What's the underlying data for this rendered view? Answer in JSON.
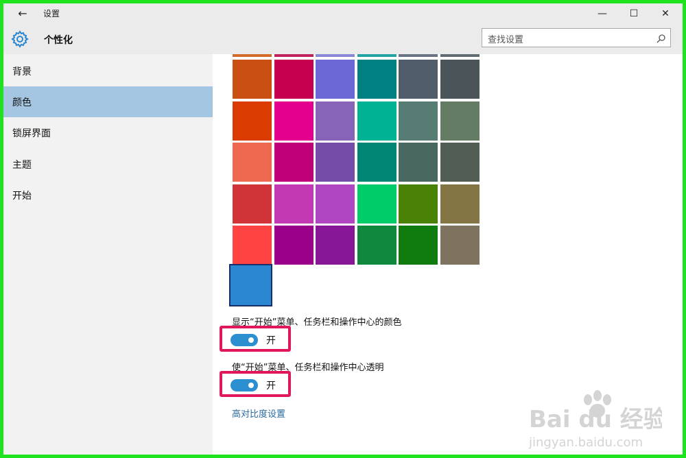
{
  "window": {
    "title": "设置",
    "back_glyph": "←",
    "minimize_glyph": "—",
    "maximize_glyph": "☐",
    "close_glyph": "✕"
  },
  "header": {
    "section_title": "个性化",
    "search_placeholder": "查找设置"
  },
  "sidebar": {
    "items": [
      {
        "label": "背景",
        "active": false
      },
      {
        "label": "颜色",
        "active": true
      },
      {
        "label": "锁屏界面",
        "active": false
      },
      {
        "label": "主题",
        "active": false
      },
      {
        "label": "开始",
        "active": false
      }
    ]
  },
  "content": {
    "color_grid": [
      [
        "#c94f12",
        "#c4004f",
        "#6b69d6",
        "#008080",
        "#515c6b",
        "#4a5459"
      ],
      [
        "#da3b01",
        "#e3008c",
        "#8764b8",
        "#00b294",
        "#567c73",
        "#647c64"
      ],
      [
        "#ef6950",
        "#bf0077",
        "#744da9",
        "#018574",
        "#486860",
        "#525e54"
      ],
      [
        "#d13438",
        "#c239b3",
        "#b146c2",
        "#00cc6a",
        "#498205",
        "#847545"
      ],
      [
        "#ff4343",
        "#9a0089",
        "#881798",
        "#10893e",
        "#107c10",
        "#7e735f"
      ]
    ],
    "top_strip_colors": [
      "#d46a2a",
      "#c0205c",
      "#8a86d8",
      "#20a4a4",
      "#6a7484",
      "#616b72"
    ],
    "selected_color": "#2b88d0",
    "toggles": [
      {
        "label": "显示“开始”菜单、任务栏和操作中心的颜色",
        "state": "开",
        "on": true
      },
      {
        "label": "使“开始”菜单、任务栏和操作中心透明",
        "state": "开",
        "on": true
      }
    ],
    "high_contrast_link": "高对比度设置"
  },
  "watermark": {
    "brand": "Bai du 经验",
    "url": "jingyan.baidu.com"
  },
  "icons": {
    "settings": "gear-icon",
    "search": "search-icon",
    "back": "back-arrow-icon"
  },
  "colors": {
    "accent": "#2c8fd0",
    "highlight_border": "#e0185b",
    "nav_active": "#a5c6e2",
    "outer_frame": "#1ee31e"
  }
}
